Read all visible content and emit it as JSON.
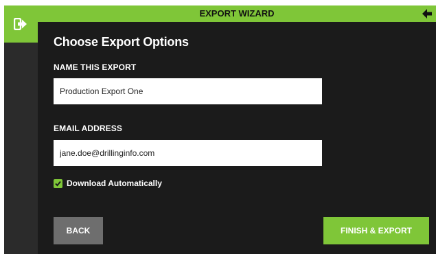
{
  "wizard": {
    "title": "EXPORT WIZARD",
    "heading": "Choose Export Options"
  },
  "form": {
    "name_label": "NAME THIS EXPORT",
    "name_value": "Production Export One",
    "email_label": "EMAIL ADDRESS",
    "email_value": "jane.doe@drillinginfo.com",
    "download_label": "Download Automatically",
    "download_checked": true
  },
  "buttons": {
    "back_label": "BACK",
    "finish_label": "FINISH & EXPORT"
  },
  "icons": {
    "rail": "sign-out-icon",
    "header": "arrow-left-icon"
  },
  "colors": {
    "accent": "#7fc638",
    "panel": "#1b1b1b",
    "rail": "#2b2b2b",
    "back_button": "#6e6e6e"
  }
}
